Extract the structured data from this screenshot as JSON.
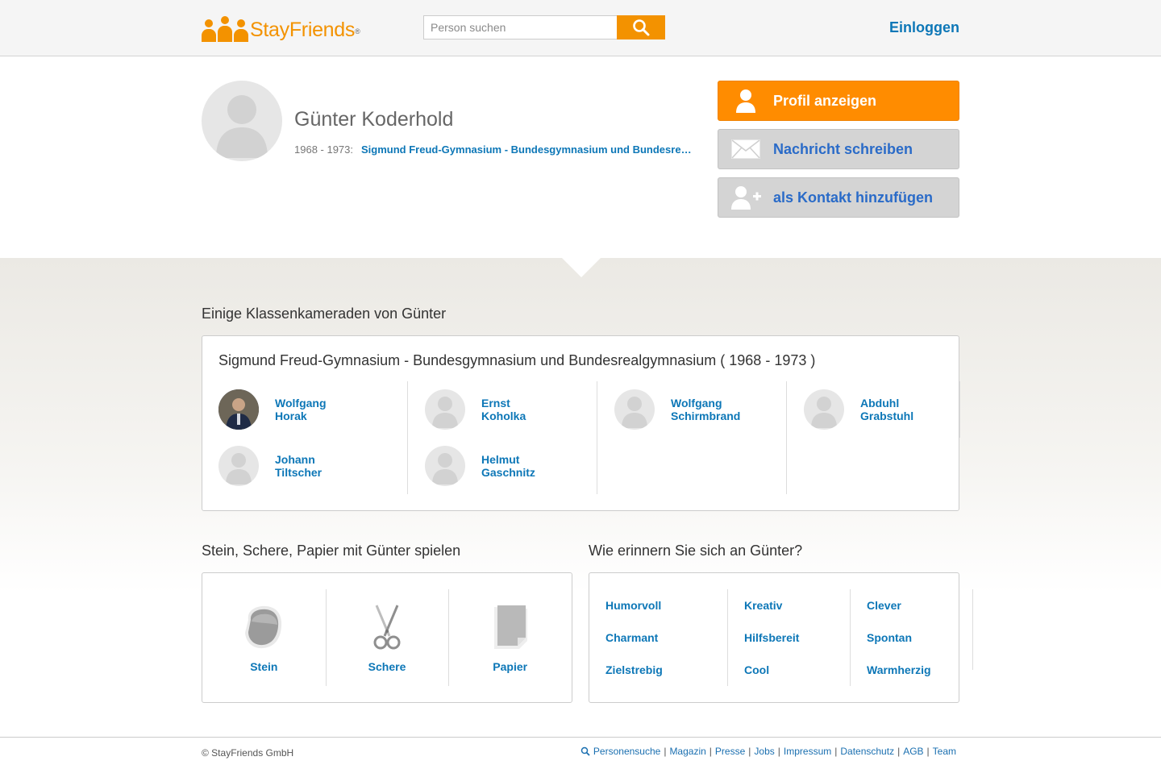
{
  "header": {
    "logo_text": "StayFriends",
    "logo_mark": "®",
    "search_placeholder": "Person suchen",
    "login_label": "Einloggen"
  },
  "profile": {
    "name": "Günter Koderhold",
    "years": "1968 - 1973:",
    "school": "Sigmund Freud-Gymnasium - Bundesgymnasium und Bundesrealgymnasium"
  },
  "actions": {
    "show_profile": "Profil anzeigen",
    "write_message": "Nachricht schreiben",
    "add_contact": "als Kontakt hinzufügen"
  },
  "classmates": {
    "title": "Einige Klassenkameraden von Günter",
    "school_heading": "Sigmund Freud-Gymnasium - Bundesgymnasium und Bundesrealgymnasium ( 1968 - 1973 )",
    "people": [
      {
        "first": "Wolfgang",
        "last": "Horak"
      },
      {
        "first": "Johann",
        "last": "Tiltscher"
      },
      {
        "first": "Ernst",
        "last": "Koholka"
      },
      {
        "first": "Helmut",
        "last": "Gaschnitz"
      },
      {
        "first": "Wolfgang",
        "last": "Schirmbrand"
      },
      {
        "first": "Abduhl",
        "last": "Grabstuhl"
      }
    ]
  },
  "game": {
    "title": "Stein, Schere, Papier mit Günter spielen",
    "options": [
      "Stein",
      "Schere",
      "Papier"
    ]
  },
  "memory": {
    "title": "Wie erinnern Sie sich an Günter?",
    "traits": [
      "Humorvoll",
      "Charmant",
      "Zielstrebig",
      "Kreativ",
      "Hilfsbereit",
      "Cool",
      "Clever",
      "Spontan",
      "Warmherzig"
    ]
  },
  "footer": {
    "copyright": "© StayFriends GmbH",
    "links": [
      "Personensuche",
      "Magazin",
      "Presse",
      "Jobs",
      "Impressum",
      "Datenschutz",
      "AGB",
      "Team"
    ]
  },
  "colors": {
    "accent": "#f39200",
    "link": "#0d77b7",
    "secondary_button": "#d4d4d4"
  }
}
